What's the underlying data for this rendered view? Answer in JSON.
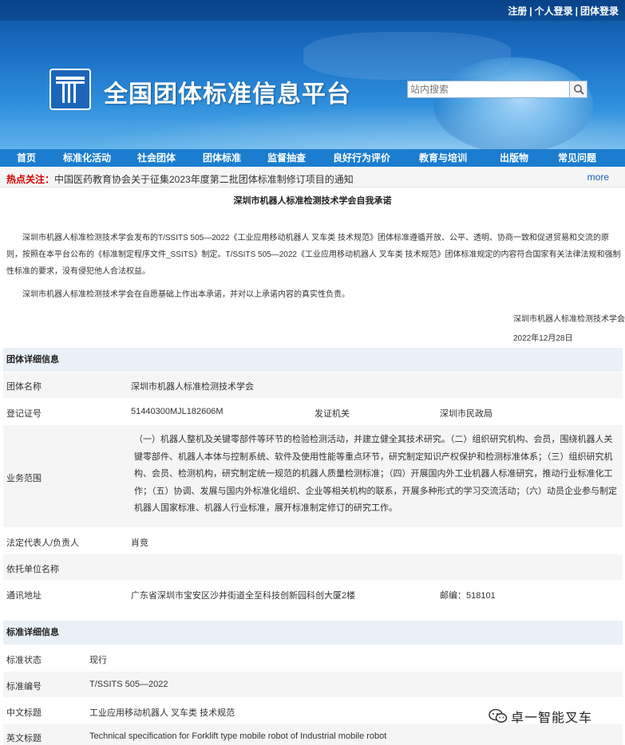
{
  "header": {
    "links": [
      "注册",
      "个人登录",
      "团体登录"
    ],
    "sep": "|",
    "site_title": "全国团体标准信息平台",
    "search_placeholder": "站内搜索",
    "search_icon": "magnifier-icon"
  },
  "nav": {
    "items": [
      "首页",
      "标准化活动",
      "社会团体",
      "团体标准",
      "监督抽查",
      "良好行为评价",
      "教育与培训",
      "出版物",
      "常见问题"
    ]
  },
  "hot": {
    "label": "热点关注：",
    "text": "中国医药教育协会关于征集2023年度第二批团体标准制修订项目的通知",
    "more": "more"
  },
  "commitment": {
    "title": "深圳市机器人标准检测技术学会自我承诺",
    "para1": "深圳市机器人标准检测技术学会发布的T/SSITS 505—2022《工业应用移动机器人 叉车类 技术规范》团体标准遵循开放、公平、透明、协商一致和促进贸易和交流的原则，按照在本平台公布的《标准制定程序文件_SSITS》制定。T/SSITS 505—2022《工业应用移动机器人 叉车类 技术规范》团体标准规定的内容符合国家有关法律法规和强制性标准的要求，没有侵犯他人合法权益。",
    "para2": "深圳市机器人标准检测技术学会在自愿基础上作出本承诺，并对以上承诺内容的真实性负责。",
    "signer": "深圳市机器人标准检测技术学会",
    "date": "2022年12月28日"
  },
  "org": {
    "section_title": "团体详细信息",
    "name_label": "团体名称",
    "name": "深圳市机器人标准检测技术学会",
    "reg_label": "登记证号",
    "reg_no": "51440300MJL182606M",
    "issuer_label": "发证机关",
    "issuer": "深圳市民政局",
    "scope_label": "业务范围",
    "scope": "（一）机器人整机及关键零部件等环节的检验检测活动，并建立健全其技术研究。（二）组织研究机构、会员，围绕机器人关键零部件、机器人本体与控制系统、软件及使用性能等重点环节，研究制定知识产权保护和检测标准体系；（三）组织研究机构、会员、检测机构，研究制定统一规范的机器人质量检测标准；（四）开展国内外工业机器人标准研究，推动行业标准化工作；（五）协调、发展与国内外标准化组织、企业等相关机构的联系，开展多种形式的学习交流活动；（六）动员企业参与制定机器人国家标准、机器人行业标准，展开标准制定修订的研究工作。",
    "legal_label": "法定代表人/负责人",
    "legal": "肖竞",
    "dep_label": "依托单位名称",
    "dep": "",
    "addr_label": "通讯地址",
    "addr": "广东省深圳市宝安区沙井街道全至科技创新园科创大厦2楼",
    "post": "邮编：518101"
  },
  "std": {
    "section_title": "标准详细信息",
    "status_label": "标准状态",
    "status": "现行",
    "code_label": "标准编号",
    "code": "T/SSITS 505—2022",
    "cn_label": "中文标题",
    "cn": "工业应用移动机器人 叉车类 技术规范",
    "en_label": "英文标题",
    "en": "Technical specification for Forklift type mobile robot of Industrial mobile robot"
  },
  "watermark": {
    "text": "卓一智能叉车",
    "icon": "wechat-icon"
  }
}
